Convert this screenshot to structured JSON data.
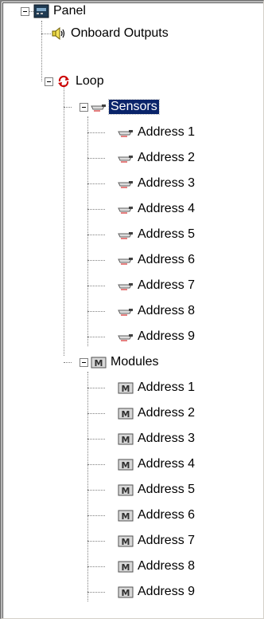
{
  "tree": {
    "root": {
      "label": "Panel",
      "icon": "panel-icon"
    },
    "onboard_outputs": {
      "label": "Onboard Outputs",
      "icon": "speaker-icon"
    },
    "loop": {
      "label": "Loop",
      "icon": "loop-icon"
    },
    "sensors": {
      "label": "Sensors",
      "icon": "sensor-icon",
      "selected": true,
      "children": [
        {
          "label": "Address 1"
        },
        {
          "label": "Address 2"
        },
        {
          "label": "Address 3"
        },
        {
          "label": "Address 4"
        },
        {
          "label": "Address 5"
        },
        {
          "label": "Address 6"
        },
        {
          "label": "Address 7"
        },
        {
          "label": "Address 8"
        },
        {
          "label": "Address 9"
        }
      ]
    },
    "modules": {
      "label": "Modules",
      "icon": "module-icon",
      "children": [
        {
          "label": "Address 1"
        },
        {
          "label": "Address 2"
        },
        {
          "label": "Address 3"
        },
        {
          "label": "Address 4"
        },
        {
          "label": "Address 5"
        },
        {
          "label": "Address 6"
        },
        {
          "label": "Address 7"
        },
        {
          "label": "Address 8"
        },
        {
          "label": "Address 9"
        }
      ]
    }
  },
  "colors": {
    "selection": "#0a246a",
    "connector": "#808080"
  }
}
